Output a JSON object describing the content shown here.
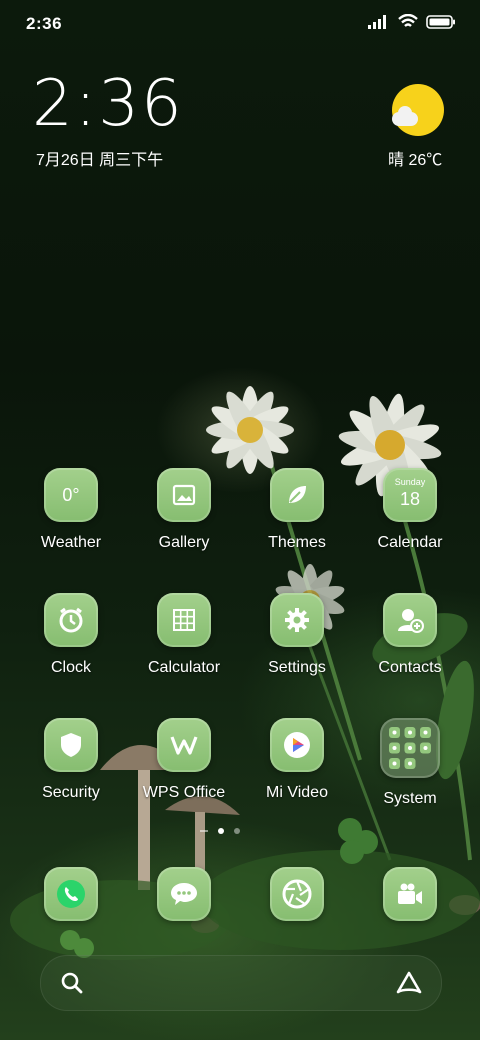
{
  "status_bar": {
    "time": "2:36"
  },
  "clock_widget": {
    "time": "2:36",
    "date": "7月26日 周三下午"
  },
  "weather_widget": {
    "condition": "晴",
    "temperature": "26℃"
  },
  "apps": {
    "weather": {
      "label": "Weather",
      "icon_text": "0°"
    },
    "gallery": {
      "label": "Gallery"
    },
    "themes": {
      "label": "Themes"
    },
    "calendar": {
      "label": "Calendar",
      "day_name": "Sunday",
      "day_number": "18"
    },
    "clock": {
      "label": "Clock"
    },
    "calculator": {
      "label": "Calculator"
    },
    "settings": {
      "label": "Settings"
    },
    "contacts": {
      "label": "Contacts"
    },
    "security": {
      "label": "Security"
    },
    "wps_office": {
      "label": "WPS Office"
    },
    "mi_video": {
      "label": "Mi Video"
    },
    "system": {
      "label": "System"
    }
  },
  "dock": [
    "phone",
    "messages",
    "camera",
    "screen-recorder"
  ],
  "page_indicator": {
    "pages": 2,
    "active": 1
  },
  "colors": {
    "icon_bg": "#94c77e",
    "sun": "#f7d21b",
    "accent_dark": "#1f3a1f"
  }
}
